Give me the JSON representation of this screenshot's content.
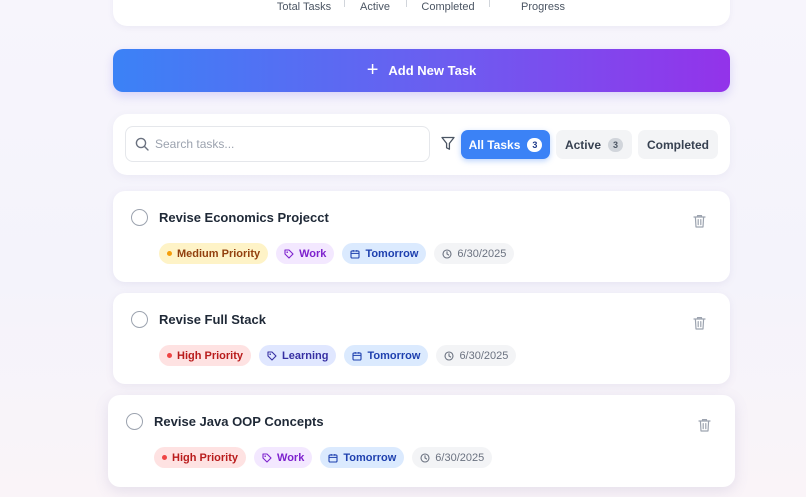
{
  "stats": {
    "total_label": "Total Tasks",
    "active_label": "Active",
    "completed_label": "Completed",
    "progress_label": "Progress"
  },
  "add_button": {
    "label": "Add New Task",
    "icon": "plus-icon"
  },
  "search": {
    "placeholder": "Search tasks...",
    "value": ""
  },
  "filters": [
    {
      "label": "All Tasks",
      "count": "3",
      "selected": true
    },
    {
      "label": "Active",
      "count": "3",
      "selected": false
    },
    {
      "label": "Completed",
      "count": "",
      "selected": false
    }
  ],
  "tasks": [
    {
      "title": "Revise Economics Projecct",
      "priority": "Medium Priority",
      "category": "Work",
      "due": "Tomorrow",
      "date": "6/30/2025",
      "completed": false
    },
    {
      "title": "Revise Full Stack",
      "priority": "High Priority",
      "category": "Learning",
      "due": "Tomorrow",
      "date": "6/30/2025",
      "completed": false
    },
    {
      "title": "Revise Java OOP Concepts",
      "priority": "High Priority",
      "category": "Work",
      "due": "Tomorrow",
      "date": "6/30/2025",
      "completed": false
    }
  ],
  "colors": {
    "accent_blue": "#3b82f6",
    "accent_purple": "#9333ea",
    "priority_medium": "#f59e0b",
    "priority_high": "#ef4444"
  }
}
